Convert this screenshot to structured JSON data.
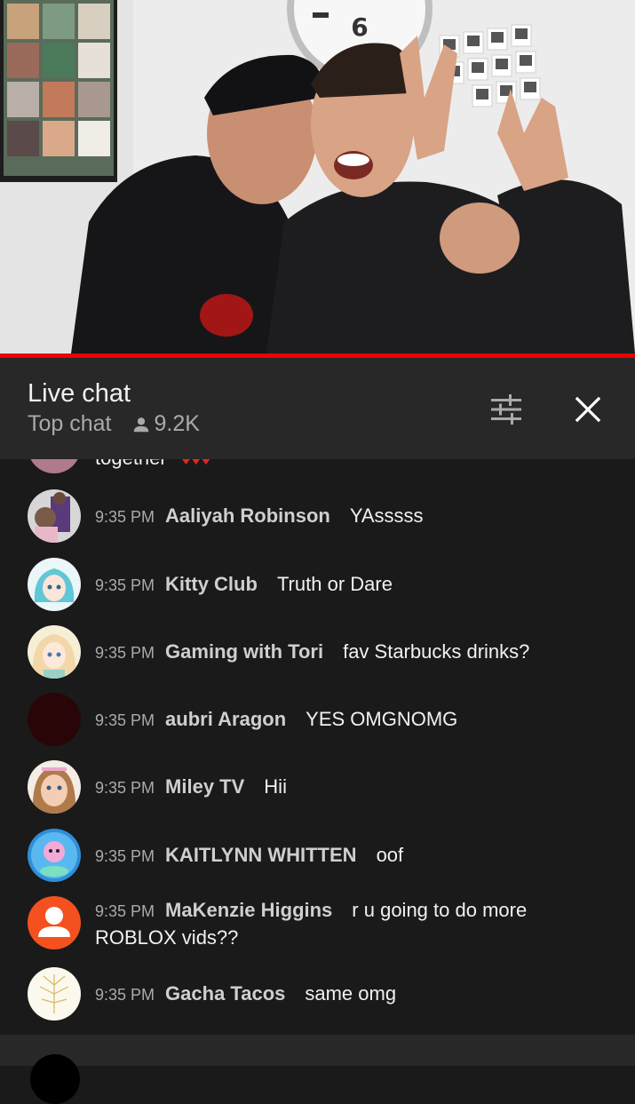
{
  "video": {
    "progress_fraction": 1.0,
    "clock_digit": "6"
  },
  "header": {
    "title": "Live chat",
    "mode": "Top chat",
    "viewers": "9.2K",
    "filter_icon": "tune-sliders-icon",
    "close_icon": "close-icon"
  },
  "chat": {
    "partial_message": "together",
    "messages": [
      {
        "time": "9:35 PM",
        "author": "Aaliyah Robinson",
        "text": "YAsssss",
        "avatar_color": "#8a8a9a"
      },
      {
        "time": "9:35 PM",
        "author": "Kitty Club",
        "text": "Truth or Dare",
        "avatar_color": "#5fc7d6"
      },
      {
        "time": "9:35 PM",
        "author": "Gaming with Tori",
        "text": "fav Starbucks drinks?",
        "avatar_color": "#f3d7a8"
      },
      {
        "time": "9:35 PM",
        "author": "aubri Aragon",
        "text": "YES OMGNOMG",
        "avatar_color": "#2a0508"
      },
      {
        "time": "9:35 PM",
        "author": "Miley TV",
        "text": "Hii",
        "avatar_color": "#e8c3a8"
      },
      {
        "time": "9:35 PM",
        "author": "KAITLYNN WHITTEN",
        "text": "oof",
        "avatar_color": "#3aa0e0"
      },
      {
        "time": "9:35 PM",
        "author": "MaKenzie Higgins",
        "text": "r u going to do more ROBLOX vids??",
        "avatar_color": "#f4511e"
      },
      {
        "time": "9:35 PM",
        "author": "Gacha Tacos",
        "text": "same omg",
        "avatar_color": "#f7f3e6"
      }
    ]
  }
}
